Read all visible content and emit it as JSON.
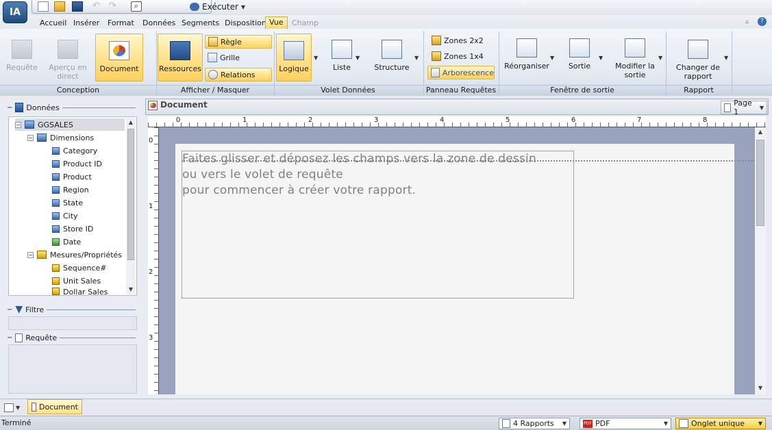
{
  "menu": {
    "tabs": [
      "Accueil",
      "Insérer",
      "Format",
      "Données",
      "Segments",
      "Disposition",
      "Vue",
      "Champ"
    ],
    "active": "Vue",
    "disabled": [
      "Champ"
    ]
  },
  "qat": {
    "execute_label": "Exécuter"
  },
  "app_logo": "IA",
  "ribbon": {
    "conception": {
      "label": "Conception",
      "requete": "Requête",
      "apercu": "Aperçu en direct",
      "document": "Document"
    },
    "afficher": {
      "label": "Afficher / Masquer",
      "ressources": "Ressources",
      "regle": "Règle",
      "grille": "Grille",
      "relations": "Relations"
    },
    "volet": {
      "label": "Volet Données",
      "logique": "Logique",
      "liste": "Liste",
      "structure": "Structure"
    },
    "panneau": {
      "label": "Panneau Requêtes",
      "zones22": "Zones 2x2",
      "zones14": "Zones 1x4",
      "arborescence": "Arborescence"
    },
    "fenetre": {
      "label": "Fenêtre de sortie",
      "reorganiser": "Réorganiser",
      "sortie": "Sortie",
      "modifier1": "Modifier la",
      "modifier2": "sortie"
    },
    "rapport": {
      "label": "Rapport",
      "changer1": "Changer de",
      "changer2": "rapport"
    }
  },
  "left": {
    "donnees_title": "Données",
    "root": "GGSALES",
    "dimensions": "Dimensions",
    "dim_items": [
      "Category",
      "Product ID",
      "Product",
      "Region",
      "State",
      "City",
      "Store ID",
      "Date"
    ],
    "mesures": "Mesures/Propriétés",
    "mes_items": [
      "Sequence#",
      "Unit Sales",
      "Dollar Sales"
    ],
    "filtre_title": "Filtre",
    "requete_title": "Requête"
  },
  "doc": {
    "title": "Document",
    "page_label": "Page 1",
    "ruler_h": [
      "0",
      "1",
      "2",
      "3",
      "4",
      "5",
      "6",
      "7",
      "8"
    ],
    "ruler_v": [
      "0",
      "1",
      "2",
      "3"
    ],
    "hint_lines": [
      "Faites glisser et déposez les champs vers la zone de dessin",
      "ou vers le volet de requête",
      "pour commencer à créer votre rapport."
    ]
  },
  "bottom_tab": "Document",
  "status": {
    "text": "Terminé",
    "rapports": "4 Rapports",
    "format": "PDF",
    "onglet": "Onglet unique"
  },
  "colors": {
    "accent": "#fbd96a",
    "canvas": "#9aa3bd",
    "tree_icon": "#3466b2"
  }
}
